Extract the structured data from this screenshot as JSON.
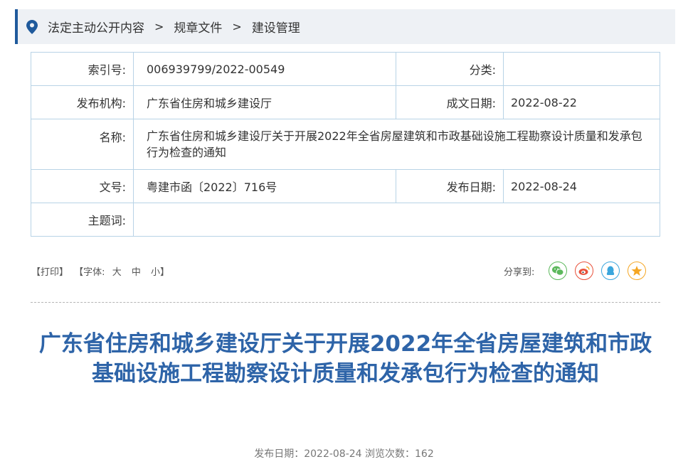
{
  "breadcrumb": {
    "items": [
      "法定主动公开内容",
      "规章文件",
      "建设管理"
    ],
    "separator": ">"
  },
  "meta": {
    "index_label": "索引号:",
    "index_value": "006939799/2022-00549",
    "category_label": "分类:",
    "category_value": "",
    "publisher_label": "发布机构:",
    "publisher_value": "广东省住房和城乡建设厅",
    "written_date_label": "成文日期:",
    "written_date_value": "2022-08-22",
    "name_label": "名称:",
    "name_value": "广东省住房和城乡建设厅关于开展2022年全省房屋建筑和市政基础设施工程勘察设计质量和发承包行为检查的通知",
    "doc_no_label": "文号:",
    "doc_no_value": "粤建市函〔2022〕716号",
    "publish_date_label": "发布日期:",
    "publish_date_value": "2022-08-24",
    "keywords_label": "主题词:",
    "keywords_value": ""
  },
  "toolbar": {
    "print": "【打印】",
    "font_open": "【字体:",
    "font_large": "大",
    "font_medium": "中",
    "font_small": "小】",
    "share_label": "分享到:"
  },
  "share_icons": [
    {
      "name": "wechat-icon",
      "color": "#5cb85c"
    },
    {
      "name": "weibo-icon",
      "color": "#e8503a"
    },
    {
      "name": "qq-icon",
      "color": "#3aa6dd"
    },
    {
      "name": "qzone-icon",
      "color": "#f5a623"
    }
  ],
  "article": {
    "title": "广东省住房和城乡建设厅关于开展2022年全省房屋建筑和市政基础设施工程勘察设计质量和发承包行为检查的通知",
    "info": "发布日期：2022-08-24  浏览次数：162"
  },
  "colors": {
    "accent": "#1f5a9c",
    "title": "#2e64a8",
    "border": "#b8d3e6"
  }
}
